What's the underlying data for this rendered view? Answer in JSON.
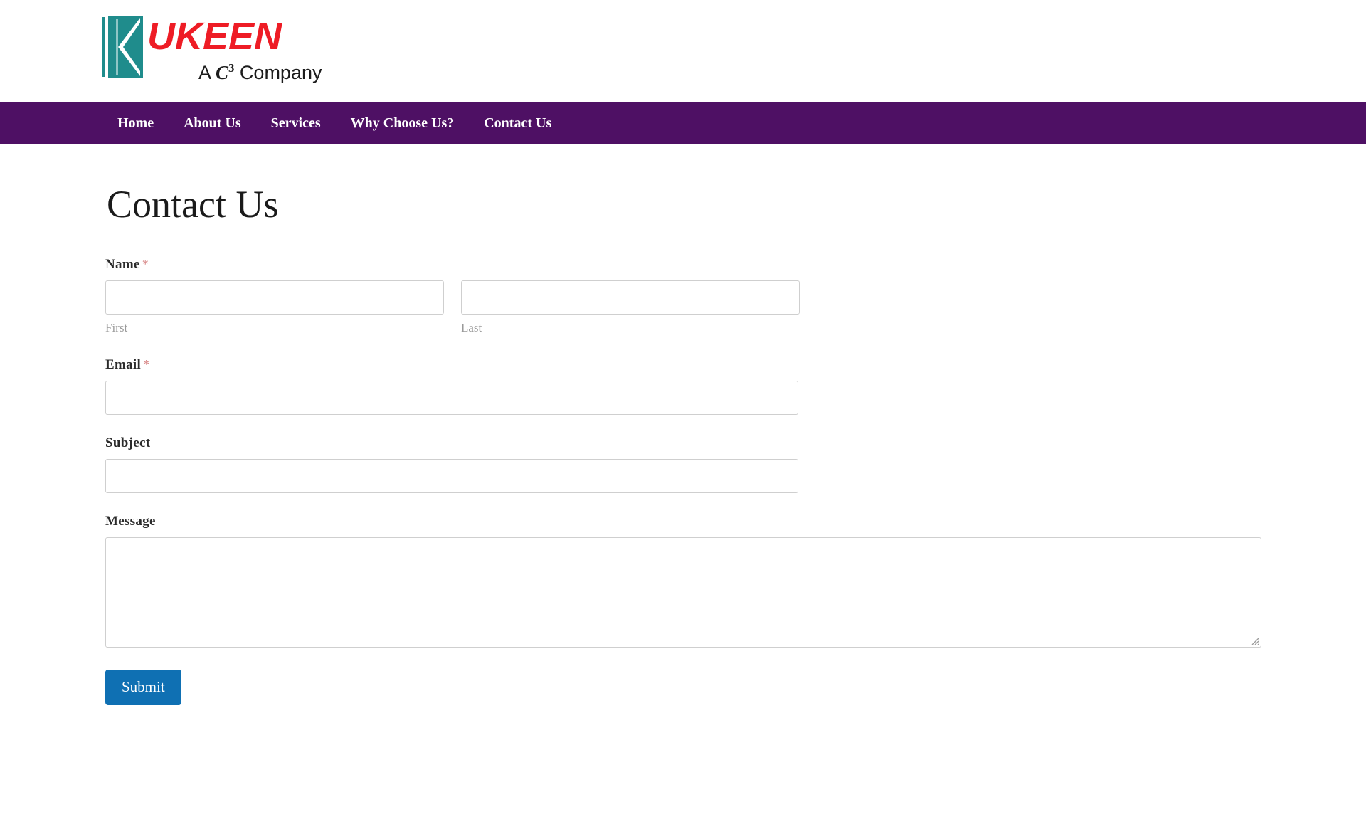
{
  "header": {
    "logo": {
      "mark_icon": "ukeen-k-logo-icon",
      "brand": "UKEEN",
      "tagline_prefix": "A ",
      "tagline_c": "C",
      "tagline_sup": "3",
      "tagline_suffix": " Company",
      "brand_color": "#ee1c25",
      "mark_color": "#1f8c8c"
    }
  },
  "nav": {
    "background_color": "#4e1064",
    "items": [
      {
        "label": "Home"
      },
      {
        "label": "About Us"
      },
      {
        "label": "Services"
      },
      {
        "label": "Why Choose Us?"
      },
      {
        "label": "Contact Us"
      }
    ]
  },
  "main": {
    "page_title": "Contact Us",
    "form": {
      "name": {
        "label": "Name",
        "required_marker": "*",
        "first": {
          "sub_label": "First",
          "value": "",
          "placeholder": ""
        },
        "last": {
          "sub_label": "Last",
          "value": "",
          "placeholder": ""
        }
      },
      "email": {
        "label": "Email",
        "required_marker": "*",
        "value": "",
        "placeholder": ""
      },
      "subject": {
        "label": "Subject",
        "value": "",
        "placeholder": ""
      },
      "message": {
        "label": "Message",
        "value": "",
        "placeholder": ""
      },
      "submit": {
        "label": "Submit",
        "color": "#0f70b3"
      }
    }
  }
}
